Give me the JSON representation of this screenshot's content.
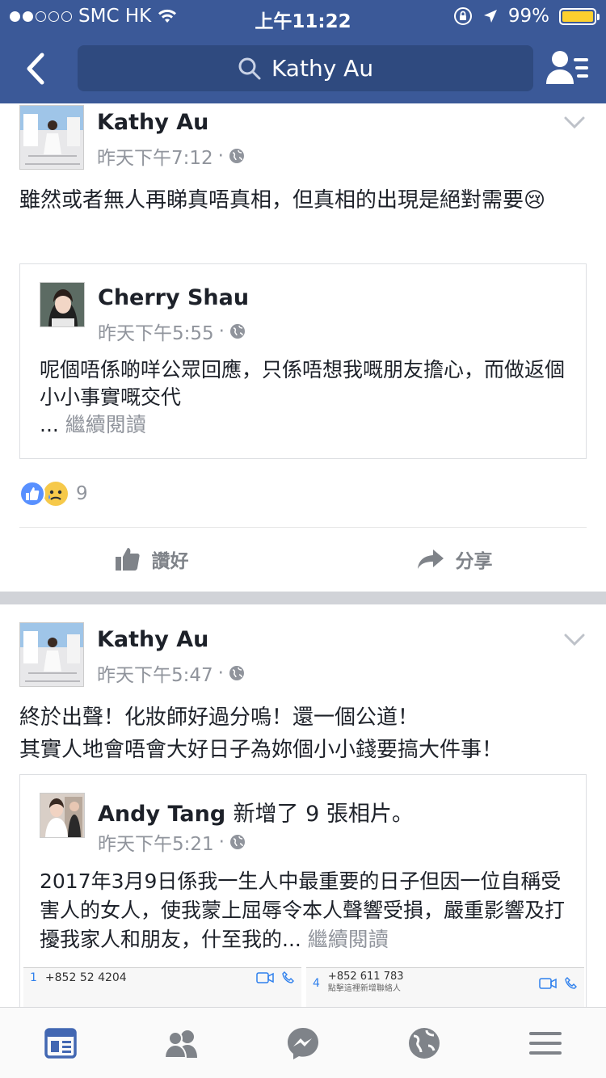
{
  "status_bar": {
    "carrier": "SMC HK",
    "time": "上午11:22",
    "battery": "99%",
    "battery_level": 0.99
  },
  "nav": {
    "search_text": "Kathy Au"
  },
  "posts": [
    {
      "author": "Kathy Au",
      "time": "昨天下午7:12",
      "text": "雖然或者無人再睇真唔真相，但真相的出現是絕對需要😢",
      "shared": {
        "author": "Cherry Shau",
        "time": "昨天下午5:55",
        "text": "呢個唔係啲咩公眾回應，只係唔想我嘅朋友擔心，而做返個小小事實嘅交代",
        "ellipsis": "...",
        "more": "繼續閱讀"
      },
      "reaction_count": "9",
      "actions": {
        "like": "讚好",
        "share": "分享"
      }
    },
    {
      "author": "Kathy Au",
      "time": "昨天下午5:47",
      "text_line1": "終於出聲！化妝師好過分嗚！還一個公道！",
      "text_line2": "其實人地會唔會大好日子為妳個小小錢要搞大件事！",
      "shared": {
        "author": "Andy Tang",
        "action": "新增了 9 張相片。",
        "time": "昨天下午5:21",
        "text": "2017年3月9日係我一生人中最重要的日子但因一位自稱受害人的女人，使我蒙上屈辱令本人聲響受損，嚴重影響及打擾我家人和朋友，什至我的...",
        "more": "繼續閱讀",
        "photo1": {
          "back": "1",
          "phone": "+852 52  4204"
        },
        "photo2": {
          "back": "4",
          "phone": "+852 611 783",
          "sub": "點擊這裡新增聯絡人"
        }
      }
    }
  ],
  "icons": {
    "back": "chevron-left-icon",
    "search": "search-icon",
    "friends": "friend-requests-icon",
    "tabs": [
      "news-feed-icon",
      "friends-icon",
      "messenger-icon",
      "globe-icon",
      "menu-icon"
    ]
  },
  "colors": {
    "brand": "#3b5998",
    "search_bg": "#2f4a7f",
    "active_tab": "#4267b2",
    "inactive_tab": "#7f8389"
  }
}
